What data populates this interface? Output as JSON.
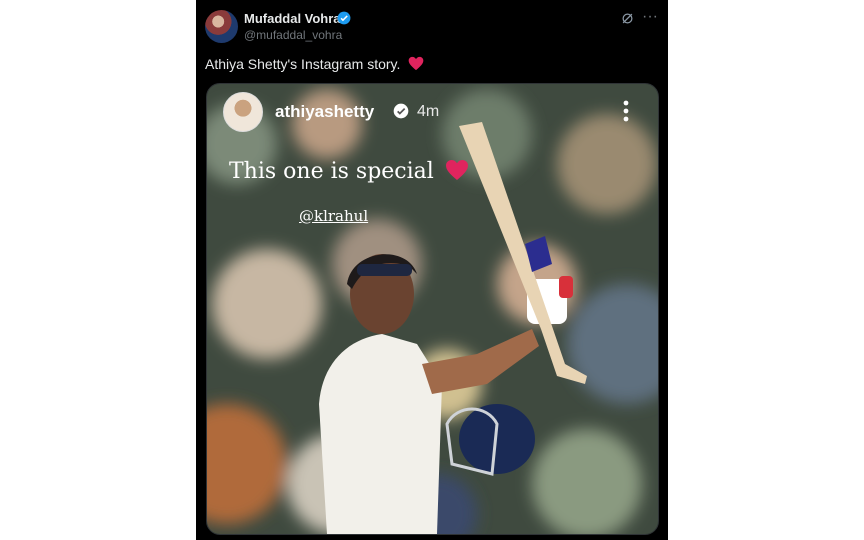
{
  "tweet": {
    "author_name": "Mufaddal Vohra",
    "author_handle": "@mufaddal_vohra",
    "text": "Athiya Shetty's Instagram story."
  },
  "story": {
    "username": "athiyashetty",
    "time": "4m",
    "caption": "This one is special",
    "mention": "@klrahul"
  },
  "colors": {
    "background": "#000000",
    "verified_blue": "#1d9bf0",
    "heart": "#e0245e"
  }
}
